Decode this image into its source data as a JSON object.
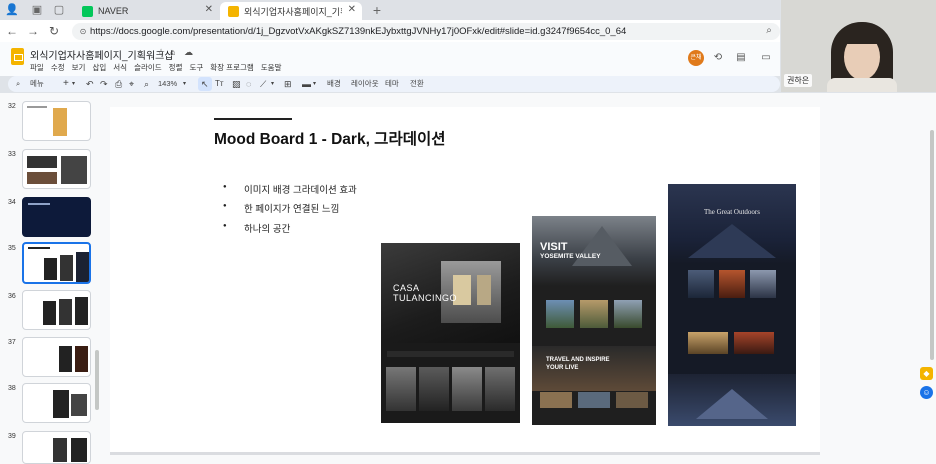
{
  "browser": {
    "tabs": [
      {
        "label": "NAVER",
        "active": false
      },
      {
        "label": "외식기업자사홈페이지_기획워크샵 - Google",
        "active": true
      }
    ],
    "url": "https://docs.google.com/presentation/d/1j_DgzvotVxAKgkSZ7139nkEJybxttgJVNHy17j0OFxk/edit#slide=id.g3247f9654cc_0_64"
  },
  "doc": {
    "title": "외식기업자사홈페이지_기획워크샵",
    "menu": [
      "파일",
      "수정",
      "보기",
      "삽입",
      "서식",
      "슬라이드",
      "정렬",
      "도구",
      "확장 프로그램",
      "도움말"
    ],
    "avatar_label": "은채"
  },
  "toolbar": {
    "search_label": "메뉴",
    "zoom": "143%",
    "background_label": "배경",
    "layout_label": "레이아웃",
    "theme_label": "테마",
    "transition_label": "전환"
  },
  "filmstrip": {
    "numbers": [
      "32",
      "33",
      "34",
      "35",
      "36",
      "37",
      "38",
      "39"
    ],
    "selected": "35"
  },
  "slide": {
    "title": "Mood Board 1 -  Dark, 그라데이션",
    "bullets": [
      "이미지 배경 그라데이션 효과",
      "한 페이지가 연결된 느낌",
      "하나의 공간"
    ],
    "mock1": {
      "heading_1": "CASA",
      "heading_2": "TULANCINGO"
    },
    "mock2": {
      "heading_1": "VISIT",
      "heading_2": "YOSEMITE VALLEY",
      "section": "TRAVEL AND INSPIRE YOUR LIVE"
    },
    "mock3": {
      "heading": "The Great Outdoors"
    }
  },
  "webcam": {
    "name": "권하은"
  },
  "colors": {
    "accent": "#1a73e8",
    "slides_yellow": "#f4b400",
    "avatar_orange": "#e07a1b"
  }
}
